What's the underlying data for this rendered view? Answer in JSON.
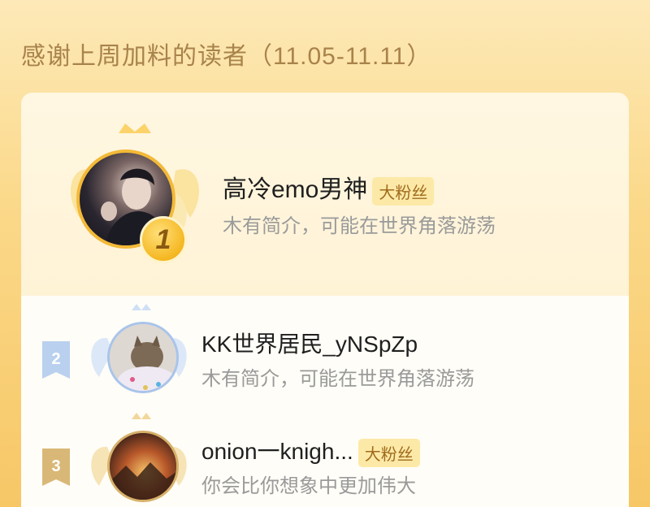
{
  "header": {
    "title": "感谢上周加料的读者（11.05-11.11）"
  },
  "first": {
    "rank": "1",
    "name": "高冷emo男神",
    "tag": "大粉丝",
    "desc": "木有简介，可能在世界角落游荡"
  },
  "rows": [
    {
      "rank": "2",
      "name": "KK世界居民_yNSpZp",
      "desc": "木有简介，可能在世界角落游荡"
    },
    {
      "rank": "3",
      "name": "onion一knigh...",
      "tag": "大粉丝",
      "desc": "你会比你想象中更加伟大"
    }
  ],
  "colors": {
    "gold": "#f3b937",
    "silver": "#a9c4ea",
    "bronze": "#d6b16a",
    "title": "#a8834a"
  }
}
